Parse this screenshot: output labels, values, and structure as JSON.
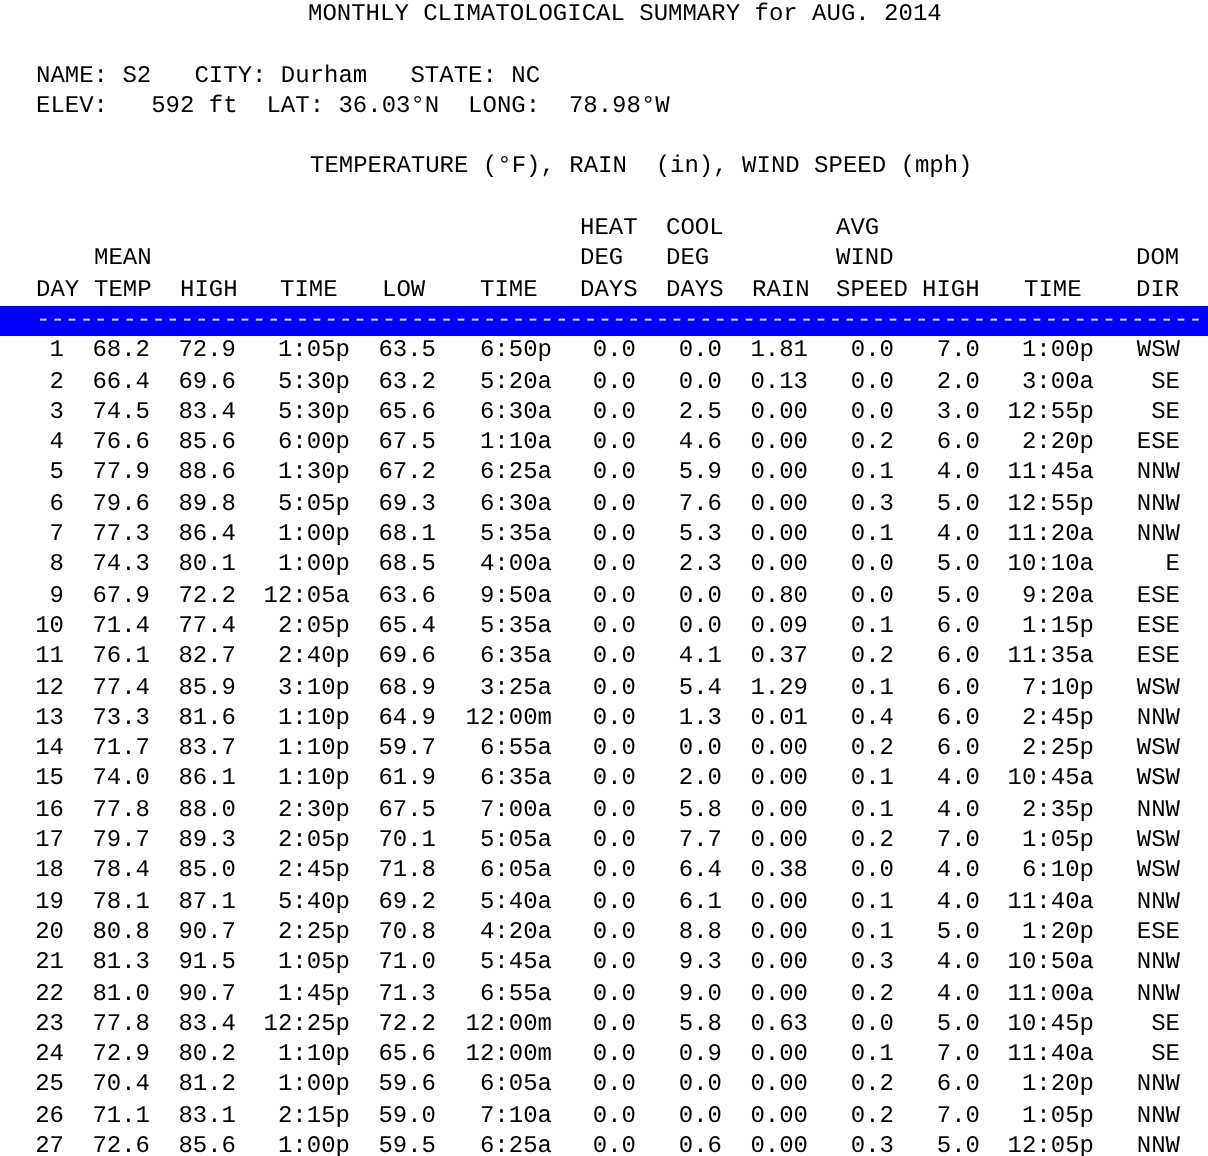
{
  "title": "MONTHLY CLIMATOLOGICAL SUMMARY for AUG. 2014",
  "info_lines": [
    "NAME: S2   CITY: Durham   STATE: NC",
    "ELEV:   592 ft  LAT: 36.03°N  LONG:  78.98°W"
  ],
  "subtitle": "TEMPERATURE (°F), RAIN  (in), WIND SPEED (mph)",
  "columns": [
    {
      "heading": [
        "DAY"
      ]
    },
    {
      "heading": [
        "MEAN",
        "TEMP"
      ]
    },
    {
      "heading": [
        "HIGH"
      ]
    },
    {
      "heading": [
        "TIME"
      ]
    },
    {
      "heading": [
        "LOW"
      ]
    },
    {
      "heading": [
        "TIME"
      ]
    },
    {
      "heading": [
        "HEAT",
        "DEG",
        "DAYS"
      ]
    },
    {
      "heading": [
        "COOL",
        "DEG",
        "DAYS"
      ]
    },
    {
      "heading": [
        "RAIN"
      ]
    },
    {
      "heading": [
        "AVG",
        "WIND",
        "SPEED"
      ]
    },
    {
      "heading": [
        "HIGH"
      ]
    },
    {
      "heading": [
        "TIME"
      ]
    },
    {
      "heading": [
        "DOM",
        "DIR"
      ]
    }
  ],
  "separator": "---------------------------------------------------------------------------------",
  "rows": [
    [
      "1",
      "68.2",
      "72.9",
      "1:05p",
      "63.5",
      "6:50p",
      "0.0",
      "0.0",
      "1.81",
      "0.0",
      "7.0",
      "1:00p",
      "WSW"
    ],
    [
      "2",
      "66.4",
      "69.6",
      "5:30p",
      "63.2",
      "5:20a",
      "0.0",
      "0.0",
      "0.13",
      "0.0",
      "2.0",
      "3:00a",
      "SE"
    ],
    [
      "3",
      "74.5",
      "83.4",
      "5:30p",
      "65.6",
      "6:30a",
      "0.0",
      "2.5",
      "0.00",
      "0.0",
      "3.0",
      "12:55p",
      "SE"
    ],
    [
      "4",
      "76.6",
      "85.6",
      "6:00p",
      "67.5",
      "1:10a",
      "0.0",
      "4.6",
      "0.00",
      "0.2",
      "6.0",
      "2:20p",
      "ESE"
    ],
    [
      "5",
      "77.9",
      "88.6",
      "1:30p",
      "67.2",
      "6:25a",
      "0.0",
      "5.9",
      "0.00",
      "0.1",
      "4.0",
      "11:45a",
      "NNW"
    ],
    [
      "6",
      "79.6",
      "89.8",
      "5:05p",
      "69.3",
      "6:30a",
      "0.0",
      "7.6",
      "0.00",
      "0.3",
      "5.0",
      "12:55p",
      "NNW"
    ],
    [
      "7",
      "77.3",
      "86.4",
      "1:00p",
      "68.1",
      "5:35a",
      "0.0",
      "5.3",
      "0.00",
      "0.1",
      "4.0",
      "11:20a",
      "NNW"
    ],
    [
      "8",
      "74.3",
      "80.1",
      "1:00p",
      "68.5",
      "4:00a",
      "0.0",
      "2.3",
      "0.00",
      "0.0",
      "5.0",
      "10:10a",
      "E"
    ],
    [
      "9",
      "67.9",
      "72.2",
      "12:05a",
      "63.6",
      "9:50a",
      "0.0",
      "0.0",
      "0.80",
      "0.0",
      "5.0",
      "9:20a",
      "ESE"
    ],
    [
      "10",
      "71.4",
      "77.4",
      "2:05p",
      "65.4",
      "5:35a",
      "0.0",
      "0.0",
      "0.09",
      "0.1",
      "6.0",
      "1:15p",
      "ESE"
    ],
    [
      "11",
      "76.1",
      "82.7",
      "2:40p",
      "69.6",
      "6:35a",
      "0.0",
      "4.1",
      "0.37",
      "0.2",
      "6.0",
      "11:35a",
      "ESE"
    ],
    [
      "12",
      "77.4",
      "85.9",
      "3:10p",
      "68.9",
      "3:25a",
      "0.0",
      "5.4",
      "1.29",
      "0.1",
      "6.0",
      "7:10p",
      "WSW"
    ],
    [
      "13",
      "73.3",
      "81.6",
      "1:10p",
      "64.9",
      "12:00m",
      "0.0",
      "1.3",
      "0.01",
      "0.4",
      "6.0",
      "2:45p",
      "NNW"
    ],
    [
      "14",
      "71.7",
      "83.7",
      "1:10p",
      "59.7",
      "6:55a",
      "0.0",
      "0.0",
      "0.00",
      "0.2",
      "6.0",
      "2:25p",
      "WSW"
    ],
    [
      "15",
      "74.0",
      "86.1",
      "1:10p",
      "61.9",
      "6:35a",
      "0.0",
      "2.0",
      "0.00",
      "0.1",
      "4.0",
      "10:45a",
      "WSW"
    ],
    [
      "16",
      "77.8",
      "88.0",
      "2:30p",
      "67.5",
      "7:00a",
      "0.0",
      "5.8",
      "0.00",
      "0.1",
      "4.0",
      "2:35p",
      "NNW"
    ],
    [
      "17",
      "79.7",
      "89.3",
      "2:05p",
      "70.1",
      "5:05a",
      "0.0",
      "7.7",
      "0.00",
      "0.2",
      "7.0",
      "1:05p",
      "WSW"
    ],
    [
      "18",
      "78.4",
      "85.0",
      "2:45p",
      "71.8",
      "6:05a",
      "0.0",
      "6.4",
      "0.38",
      "0.0",
      "4.0",
      "6:10p",
      "WSW"
    ],
    [
      "19",
      "78.1",
      "87.1",
      "5:40p",
      "69.2",
      "5:40a",
      "0.0",
      "6.1",
      "0.00",
      "0.1",
      "4.0",
      "11:40a",
      "NNW"
    ],
    [
      "20",
      "80.8",
      "90.7",
      "2:25p",
      "70.8",
      "4:20a",
      "0.0",
      "8.8",
      "0.00",
      "0.1",
      "5.0",
      "1:20p",
      "ESE"
    ],
    [
      "21",
      "81.3",
      "91.5",
      "1:05p",
      "71.0",
      "5:45a",
      "0.0",
      "9.3",
      "0.00",
      "0.3",
      "4.0",
      "10:50a",
      "NNW"
    ],
    [
      "22",
      "81.0",
      "90.7",
      "1:45p",
      "71.3",
      "6:55a",
      "0.0",
      "9.0",
      "0.00",
      "0.2",
      "4.0",
      "11:00a",
      "NNW"
    ],
    [
      "23",
      "77.8",
      "83.4",
      "12:25p",
      "72.2",
      "12:00m",
      "0.0",
      "5.8",
      "0.63",
      "0.0",
      "5.0",
      "10:45p",
      "SE"
    ],
    [
      "24",
      "72.9",
      "80.2",
      "1:10p",
      "65.6",
      "12:00m",
      "0.0",
      "0.9",
      "0.00",
      "0.1",
      "7.0",
      "11:40a",
      "SE"
    ],
    [
      "25",
      "70.4",
      "81.2",
      "1:00p",
      "59.6",
      "6:05a",
      "0.0",
      "0.0",
      "0.00",
      "0.2",
      "6.0",
      "1:20p",
      "NNW"
    ],
    [
      "26",
      "71.1",
      "83.1",
      "2:15p",
      "59.0",
      "7:10a",
      "0.0",
      "0.0",
      "0.00",
      "0.2",
      "7.0",
      "1:05p",
      "NNW"
    ],
    [
      "27",
      "72.6",
      "85.6",
      "1:00p",
      "59.5",
      "6:25a",
      "0.0",
      "0.6",
      "0.00",
      "0.3",
      "5.0",
      "12:05p",
      "NNW"
    ]
  ]
}
